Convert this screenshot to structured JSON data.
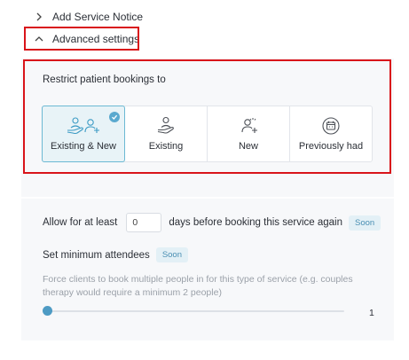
{
  "sections": {
    "notice_label": "Add Service Notice",
    "advanced_label": "Advanced settings"
  },
  "restrict": {
    "label": "Restrict patient bookings to",
    "options": [
      {
        "label": "Existing & New",
        "icon": "existing-and-new-icon",
        "selected": true
      },
      {
        "label": "Existing",
        "icon": "existing-patient-icon",
        "selected": false
      },
      {
        "label": "New",
        "icon": "new-patient-icon",
        "selected": false
      },
      {
        "label": "Previously had",
        "icon": "calendar-history-icon",
        "selected": false
      }
    ]
  },
  "allow": {
    "prefix": "Allow for at least",
    "value": "0",
    "suffix": "days before booking this service again",
    "badge": "Soon"
  },
  "minimum": {
    "label": "Set minimum attendees",
    "badge": "Soon",
    "help": "Force clients to book multiple people in for this type of service (e.g. couples therapy would require a minimum 2 people)",
    "slider_value": "1",
    "slider_min": 1,
    "slider_max": 10
  },
  "colors": {
    "highlight": "#d9141a",
    "accent": "#5aa9cf",
    "selected_bg": "#e8f3f7",
    "badge_bg": "#e3f0f6"
  }
}
